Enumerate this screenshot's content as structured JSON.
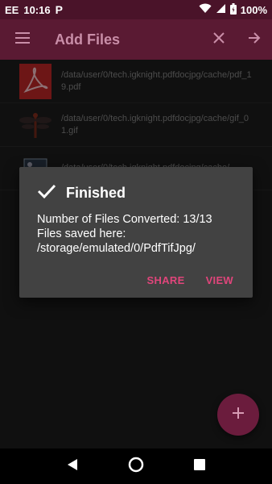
{
  "status_bar": {
    "carrier": "EE",
    "time": "10:16",
    "app_badge": "P",
    "battery_percent": "100%",
    "icons": [
      "wifi-icon",
      "signal-icon",
      "battery-icon"
    ]
  },
  "app_bar": {
    "title": "Add Files",
    "icons": [
      "menu-icon",
      "close-icon",
      "arrow-forward-icon"
    ]
  },
  "files": [
    {
      "path": "/data/user/0/tech.igknight.pdfdocjpg/cache/pdf_19.pdf",
      "thumb": "pdf-thumbnail"
    },
    {
      "path": "/data/user/0/tech.igknight.pdfdocjpg/cache/gif_01.gif",
      "thumb": "gif-thumbnail"
    },
    {
      "path": "/data/user/0/tech.igknight.pdfdocjpg/cache/",
      "thumb": "image-thumbnail"
    }
  ],
  "dialog": {
    "title": "Finished",
    "line1": "Number of Files Converted: 13/13",
    "line2": "Files saved here: /storage/emulated/0/PdfTifJpg/",
    "share_label": "SHARE",
    "view_label": "VIEW"
  },
  "fab": {
    "icon": "add-icon"
  },
  "colors": {
    "status_bar": "#4a1329",
    "app_bar": "#5a1a33",
    "accent": "#e0457b",
    "dialog": "#424242"
  }
}
